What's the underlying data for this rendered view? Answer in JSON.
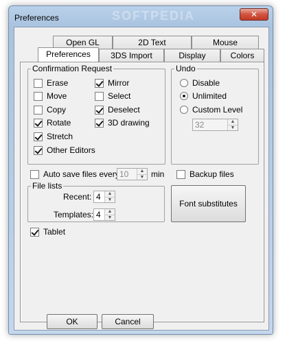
{
  "window": {
    "title": "Preferences",
    "watermark": "SOFTPEDIA",
    "close_label": "✕"
  },
  "tabs": {
    "row1": [
      "Open GL",
      "2D Text",
      "Mouse"
    ],
    "row2": [
      "Preferences",
      "3DS Import",
      "Display",
      "Colors"
    ],
    "active": "Preferences"
  },
  "confirmation": {
    "title": "Confirmation Request",
    "left_items": [
      {
        "label": "Erase",
        "checked": false
      },
      {
        "label": "Move",
        "checked": false
      },
      {
        "label": "Copy",
        "checked": false
      },
      {
        "label": "Rotate",
        "checked": true
      },
      {
        "label": "Stretch",
        "checked": true
      },
      {
        "label": "Other Editors",
        "checked": true
      }
    ],
    "right_items": [
      {
        "label": "Mirror",
        "checked": true
      },
      {
        "label": "Select",
        "checked": false
      },
      {
        "label": "Deselect",
        "checked": true
      },
      {
        "label": "3D drawing",
        "checked": true
      }
    ]
  },
  "undo": {
    "title": "Undo",
    "options": [
      "Disable",
      "Unlimited",
      "Custom Level"
    ],
    "selected": "Unlimited",
    "custom_level_value": "32"
  },
  "autosave": {
    "label": "Auto save files every",
    "value": "10",
    "unit": "min",
    "checked": false
  },
  "backup": {
    "label": "Backup files",
    "checked": false
  },
  "file_lists": {
    "title": "File lists",
    "recent_label": "Recent:",
    "recent_value": "4",
    "templates_label": "Templates:",
    "templates_value": "4"
  },
  "font_substitutes_label": "Font substitutes",
  "tablet": {
    "label": "Tablet",
    "checked": true
  },
  "buttons": {
    "ok": "OK",
    "cancel": "Cancel"
  }
}
